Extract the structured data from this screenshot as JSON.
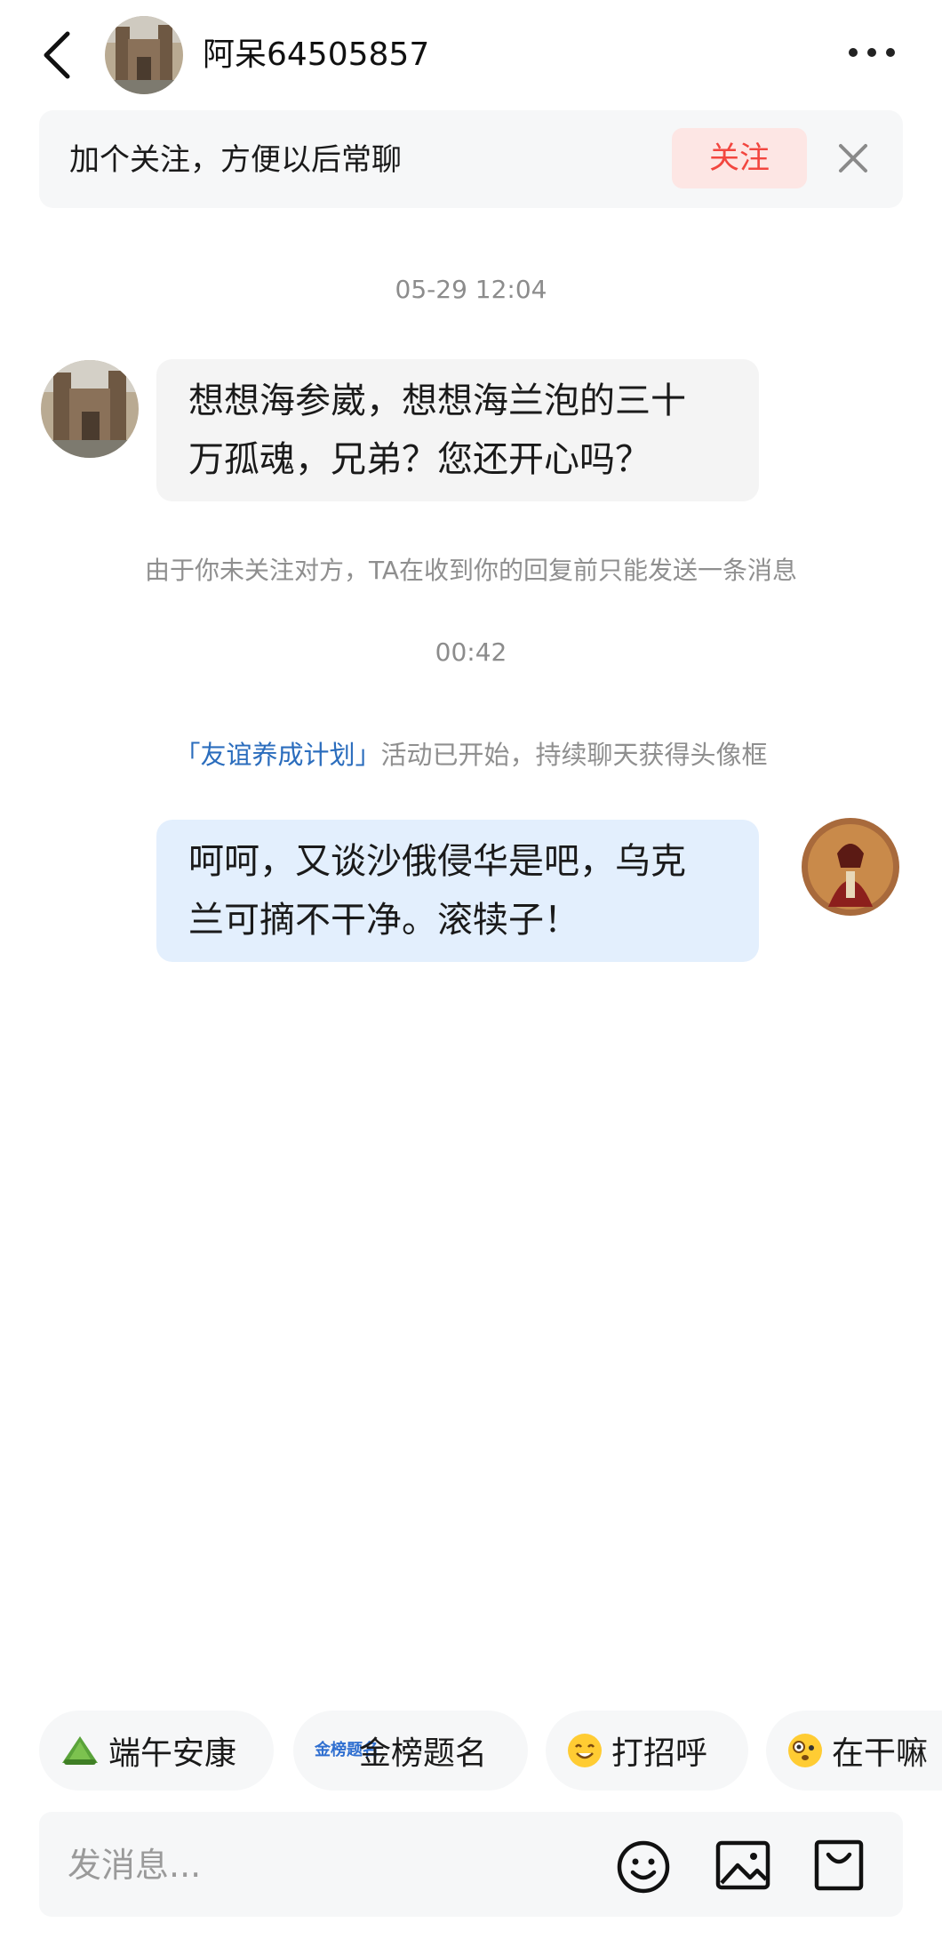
{
  "header": {
    "back_icon": "chevron-left-icon",
    "contact_name": "阿呆64505857",
    "more_icon": "more-horizontal-icon"
  },
  "follow_banner": {
    "text": "加个关注，方便以后常聊",
    "button_label": "关注",
    "close_icon": "close-icon"
  },
  "messages": [
    {
      "type": "timestamp",
      "text": "05-29 12:04"
    },
    {
      "type": "incoming",
      "lines": [
        "想想海参崴，想想海兰泡的三十",
        "万孤魂，兄弟？您还开心吗？"
      ]
    },
    {
      "type": "system",
      "text": "由于你未关注对方，TA在收到你的回复前只能发送一条消息"
    },
    {
      "type": "timestamp",
      "text": "00:42"
    },
    {
      "type": "activity",
      "link": "「友谊养成计划」",
      "text": "活动已开始，持续聊天获得头像框"
    },
    {
      "type": "outgoing",
      "lines": [
        "呵呵，又谈沙俄侵华是吧，乌克",
        "兰可摘不干净。滚犊子！"
      ]
    }
  ],
  "quick_replies": [
    {
      "icon": "zongzi-icon",
      "label": "端午安康"
    },
    {
      "icon": "gold-list-badge-icon",
      "badge_text": "金榜题名",
      "label": "金榜题名"
    },
    {
      "icon": "smile-emoji-icon",
      "label": "打招呼"
    },
    {
      "icon": "curious-emoji-icon",
      "label": "在干嘛"
    }
  ],
  "composer": {
    "placeholder": "发消息...",
    "emoji_icon": "emoji-icon",
    "image_icon": "image-icon",
    "bag_icon": "shopping-bag-icon"
  },
  "colors": {
    "accent_red": "#f2463f",
    "follow_button_bg": "#fde6e4",
    "outgoing_bubble": "#e3effd",
    "incoming_bubble": "#f4f4f4",
    "link_blue": "#2b6dbd"
  }
}
